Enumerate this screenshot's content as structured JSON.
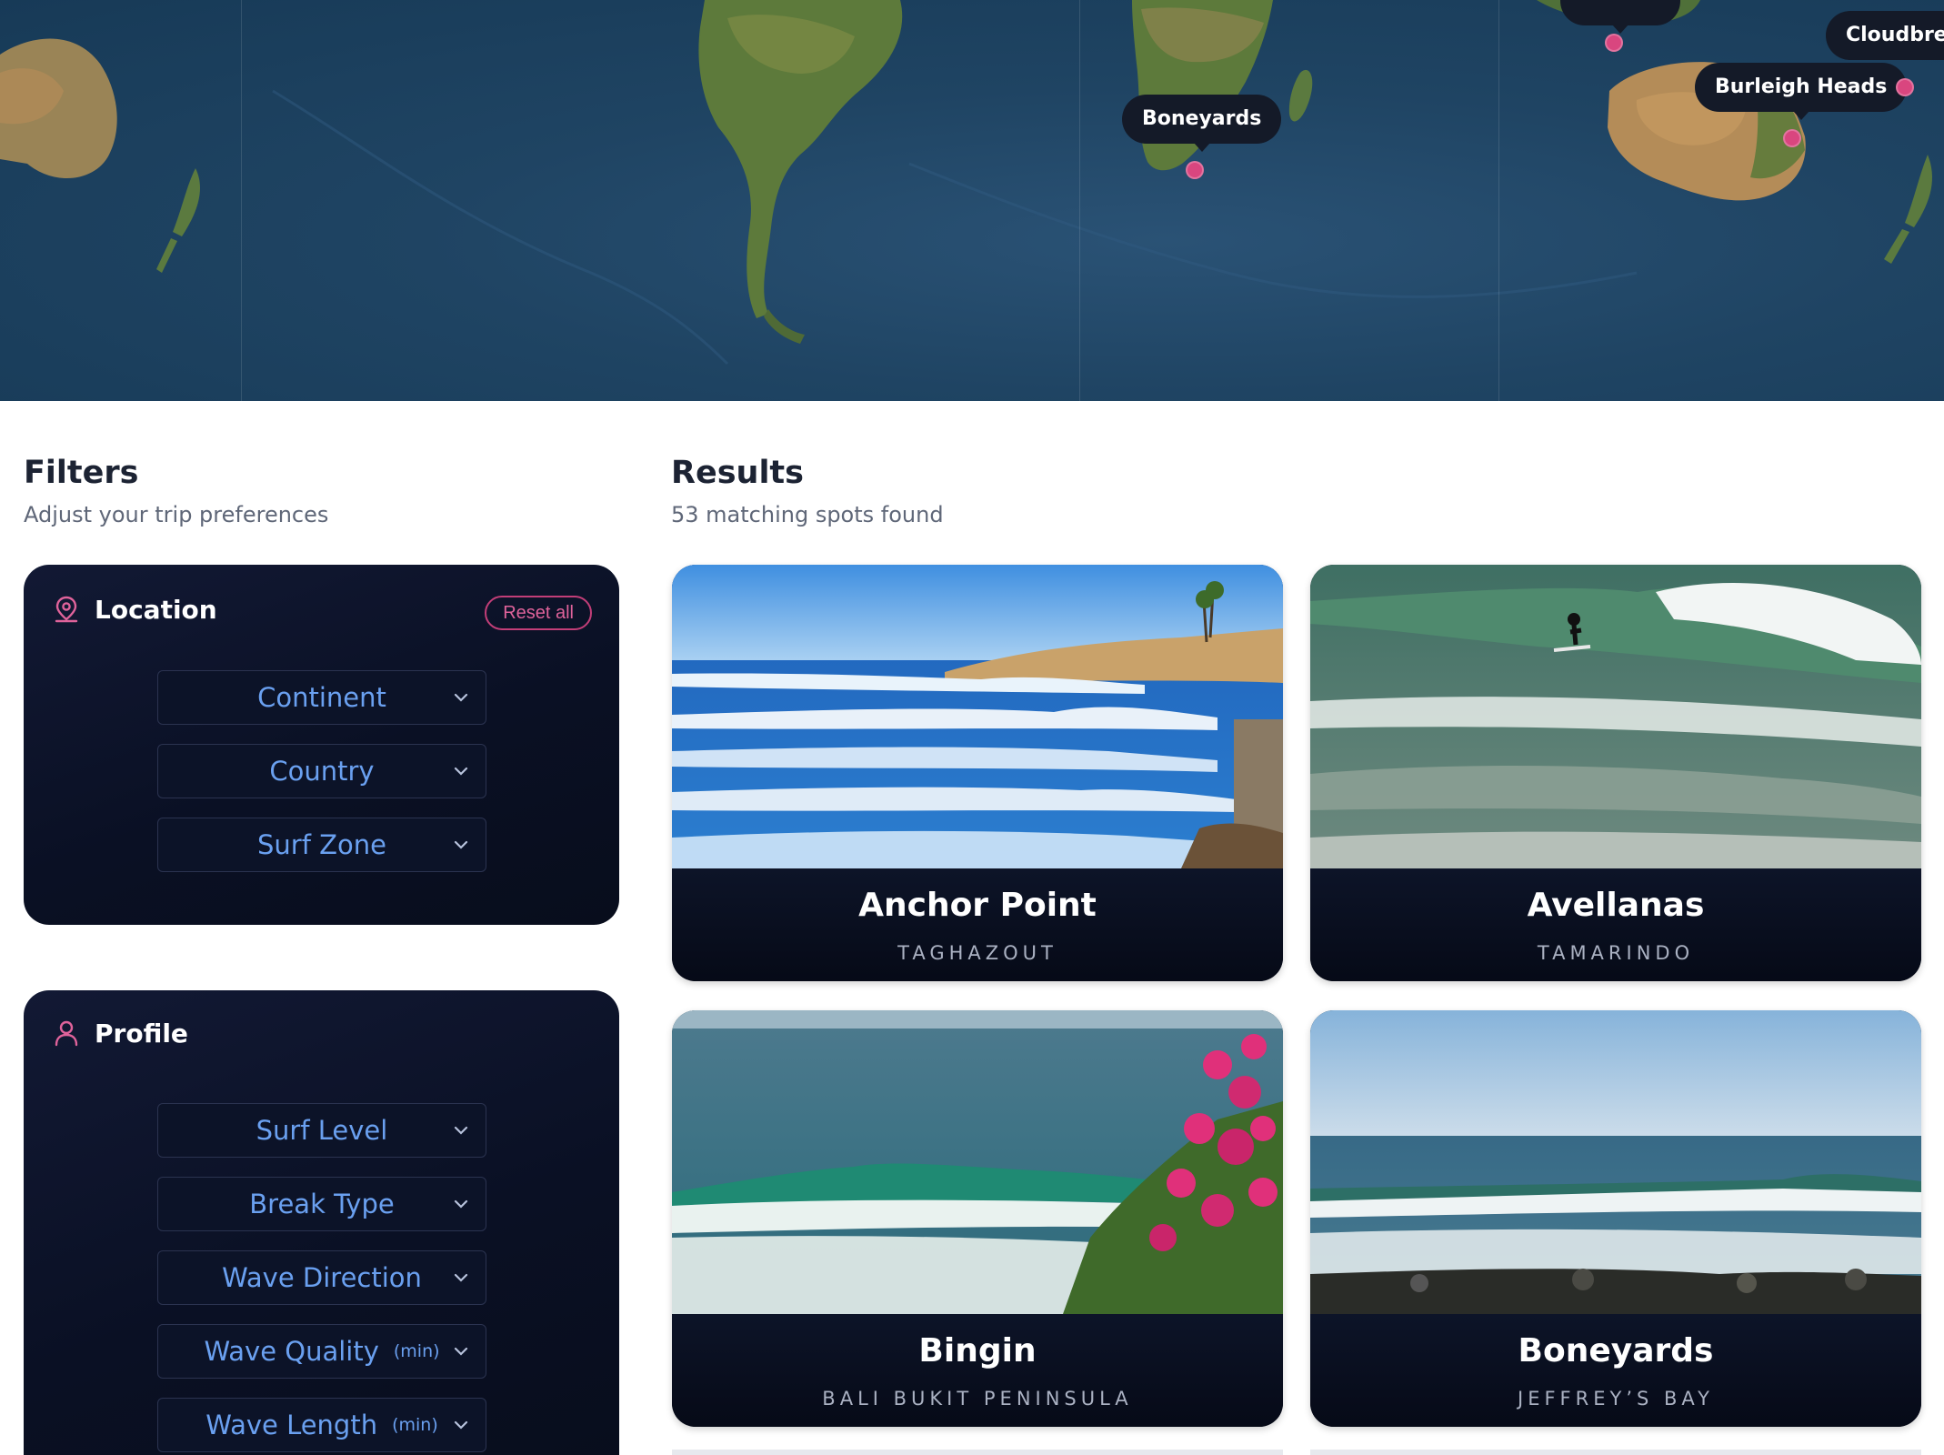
{
  "map": {
    "labels": {
      "boneyards": "Boneyards",
      "burleigh": "Burleigh Heads",
      "cloudbreak": "Cloudbrea"
    }
  },
  "filters": {
    "title": "Filters",
    "subtitle": "Adjust your trip preferences",
    "location": {
      "title": "Location",
      "reset_label": "Reset all",
      "continent": "Continent",
      "country": "Country",
      "surf_zone": "Surf Zone"
    },
    "profile": {
      "title": "Profile",
      "surf_level": "Surf Level",
      "break_type": "Break Type",
      "wave_direction": "Wave Direction",
      "wave_quality": "Wave Quality",
      "wave_length": "Wave Length",
      "min_tag": "(min)"
    }
  },
  "results": {
    "title": "Results",
    "subtitle": "53 matching spots found",
    "cards": [
      {
        "name": "Anchor Point",
        "location": "TAGHAZOUT"
      },
      {
        "name": "Avellanas",
        "location": "TAMARINDO"
      },
      {
        "name": "Bingin",
        "location": "BALI BUKIT PENINSULA"
      },
      {
        "name": "Boneyards",
        "location": "JEFFREY’S BAY"
      }
    ]
  },
  "colors": {
    "accent_pink": "#d9467f",
    "panel_bg": "#0a1024",
    "select_text": "#6aa0f0"
  }
}
